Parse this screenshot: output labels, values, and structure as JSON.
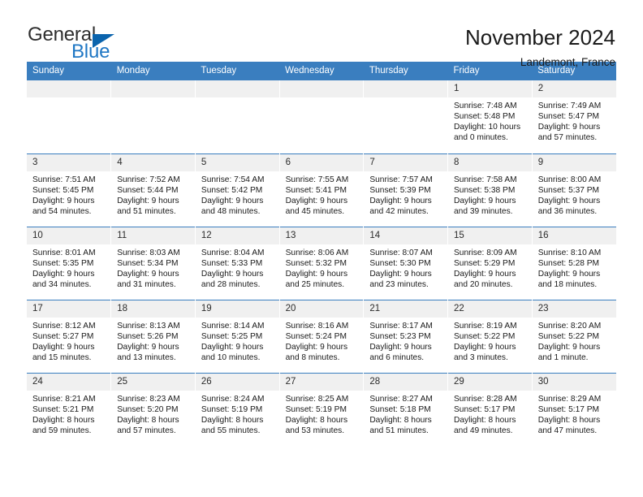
{
  "brand": {
    "word_one": "General",
    "word_two": "Blue",
    "accent_color": "#1f77c4",
    "triangle_color": "#0b64ad"
  },
  "header": {
    "title": "November 2024",
    "subtitle": "Landemont, France"
  },
  "theme": {
    "header_bg": "#3a7ebf",
    "day_band_bg": "#f0f0f0",
    "text": "#1a1a1a"
  },
  "calendar": {
    "weekday_headers": [
      "Sunday",
      "Monday",
      "Tuesday",
      "Wednesday",
      "Thursday",
      "Friday",
      "Saturday"
    ],
    "weeks": [
      [
        {
          "day": "",
          "lines": []
        },
        {
          "day": "",
          "lines": []
        },
        {
          "day": "",
          "lines": []
        },
        {
          "day": "",
          "lines": []
        },
        {
          "day": "",
          "lines": []
        },
        {
          "day": "1",
          "lines": [
            "Sunrise: 7:48 AM",
            "Sunset: 5:48 PM",
            "Daylight: 10 hours and 0 minutes."
          ]
        },
        {
          "day": "2",
          "lines": [
            "Sunrise: 7:49 AM",
            "Sunset: 5:47 PM",
            "Daylight: 9 hours and 57 minutes."
          ]
        }
      ],
      [
        {
          "day": "3",
          "lines": [
            "Sunrise: 7:51 AM",
            "Sunset: 5:45 PM",
            "Daylight: 9 hours and 54 minutes."
          ]
        },
        {
          "day": "4",
          "lines": [
            "Sunrise: 7:52 AM",
            "Sunset: 5:44 PM",
            "Daylight: 9 hours and 51 minutes."
          ]
        },
        {
          "day": "5",
          "lines": [
            "Sunrise: 7:54 AM",
            "Sunset: 5:42 PM",
            "Daylight: 9 hours and 48 minutes."
          ]
        },
        {
          "day": "6",
          "lines": [
            "Sunrise: 7:55 AM",
            "Sunset: 5:41 PM",
            "Daylight: 9 hours and 45 minutes."
          ]
        },
        {
          "day": "7",
          "lines": [
            "Sunrise: 7:57 AM",
            "Sunset: 5:39 PM",
            "Daylight: 9 hours and 42 minutes."
          ]
        },
        {
          "day": "8",
          "lines": [
            "Sunrise: 7:58 AM",
            "Sunset: 5:38 PM",
            "Daylight: 9 hours and 39 minutes."
          ]
        },
        {
          "day": "9",
          "lines": [
            "Sunrise: 8:00 AM",
            "Sunset: 5:37 PM",
            "Daylight: 9 hours and 36 minutes."
          ]
        }
      ],
      [
        {
          "day": "10",
          "lines": [
            "Sunrise: 8:01 AM",
            "Sunset: 5:35 PM",
            "Daylight: 9 hours and 34 minutes."
          ]
        },
        {
          "day": "11",
          "lines": [
            "Sunrise: 8:03 AM",
            "Sunset: 5:34 PM",
            "Daylight: 9 hours and 31 minutes."
          ]
        },
        {
          "day": "12",
          "lines": [
            "Sunrise: 8:04 AM",
            "Sunset: 5:33 PM",
            "Daylight: 9 hours and 28 minutes."
          ]
        },
        {
          "day": "13",
          "lines": [
            "Sunrise: 8:06 AM",
            "Sunset: 5:32 PM",
            "Daylight: 9 hours and 25 minutes."
          ]
        },
        {
          "day": "14",
          "lines": [
            "Sunrise: 8:07 AM",
            "Sunset: 5:30 PM",
            "Daylight: 9 hours and 23 minutes."
          ]
        },
        {
          "day": "15",
          "lines": [
            "Sunrise: 8:09 AM",
            "Sunset: 5:29 PM",
            "Daylight: 9 hours and 20 minutes."
          ]
        },
        {
          "day": "16",
          "lines": [
            "Sunrise: 8:10 AM",
            "Sunset: 5:28 PM",
            "Daylight: 9 hours and 18 minutes."
          ]
        }
      ],
      [
        {
          "day": "17",
          "lines": [
            "Sunrise: 8:12 AM",
            "Sunset: 5:27 PM",
            "Daylight: 9 hours and 15 minutes."
          ]
        },
        {
          "day": "18",
          "lines": [
            "Sunrise: 8:13 AM",
            "Sunset: 5:26 PM",
            "Daylight: 9 hours and 13 minutes."
          ]
        },
        {
          "day": "19",
          "lines": [
            "Sunrise: 8:14 AM",
            "Sunset: 5:25 PM",
            "Daylight: 9 hours and 10 minutes."
          ]
        },
        {
          "day": "20",
          "lines": [
            "Sunrise: 8:16 AM",
            "Sunset: 5:24 PM",
            "Daylight: 9 hours and 8 minutes."
          ]
        },
        {
          "day": "21",
          "lines": [
            "Sunrise: 8:17 AM",
            "Sunset: 5:23 PM",
            "Daylight: 9 hours and 6 minutes."
          ]
        },
        {
          "day": "22",
          "lines": [
            "Sunrise: 8:19 AM",
            "Sunset: 5:22 PM",
            "Daylight: 9 hours and 3 minutes."
          ]
        },
        {
          "day": "23",
          "lines": [
            "Sunrise: 8:20 AM",
            "Sunset: 5:22 PM",
            "Daylight: 9 hours and 1 minute."
          ]
        }
      ],
      [
        {
          "day": "24",
          "lines": [
            "Sunrise: 8:21 AM",
            "Sunset: 5:21 PM",
            "Daylight: 8 hours and 59 minutes."
          ]
        },
        {
          "day": "25",
          "lines": [
            "Sunrise: 8:23 AM",
            "Sunset: 5:20 PM",
            "Daylight: 8 hours and 57 minutes."
          ]
        },
        {
          "day": "26",
          "lines": [
            "Sunrise: 8:24 AM",
            "Sunset: 5:19 PM",
            "Daylight: 8 hours and 55 minutes."
          ]
        },
        {
          "day": "27",
          "lines": [
            "Sunrise: 8:25 AM",
            "Sunset: 5:19 PM",
            "Daylight: 8 hours and 53 minutes."
          ]
        },
        {
          "day": "28",
          "lines": [
            "Sunrise: 8:27 AM",
            "Sunset: 5:18 PM",
            "Daylight: 8 hours and 51 minutes."
          ]
        },
        {
          "day": "29",
          "lines": [
            "Sunrise: 8:28 AM",
            "Sunset: 5:17 PM",
            "Daylight: 8 hours and 49 minutes."
          ]
        },
        {
          "day": "30",
          "lines": [
            "Sunrise: 8:29 AM",
            "Sunset: 5:17 PM",
            "Daylight: 8 hours and 47 minutes."
          ]
        }
      ]
    ]
  }
}
